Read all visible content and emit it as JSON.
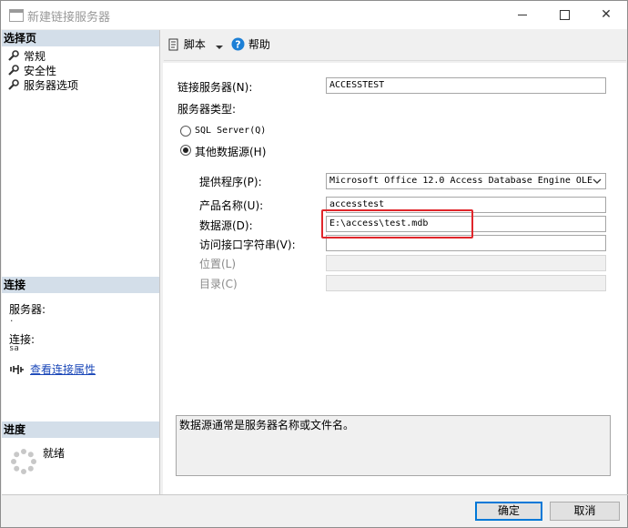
{
  "window": {
    "title": "新建链接服务器",
    "minimize_icon": "minimize-icon",
    "maximize_icon": "maximize-icon",
    "close_icon": "close-icon",
    "close_glyph": "✕"
  },
  "sidebar": {
    "select_page_header": "选择页",
    "pages": [
      {
        "label": "常规",
        "icon": "wrench-icon"
      },
      {
        "label": "安全性",
        "icon": "wrench-icon"
      },
      {
        "label": "服务器选项",
        "icon": "wrench-icon"
      }
    ],
    "connection_header": "连接",
    "server_label": "服务器:",
    "server_value": ".",
    "connection_label": "连接:",
    "connection_value": "sa",
    "view_connection_link": "查看连接属性",
    "progress_header": "进度",
    "progress_status": "就绪"
  },
  "toolbar": {
    "script_label": "脚本",
    "help_label": "帮助"
  },
  "form": {
    "linked_server_label": "链接服务器(N):",
    "linked_server_value": "ACCESSTEST",
    "server_type_label": "服务器类型:",
    "radio_sql_server": "SQL Server(Q)",
    "radio_other": "其他数据源(H)",
    "selected_type": "其他数据源(H)",
    "provider_label": "提供程序(P):",
    "provider_value": "Microsoft Office 12.0 Access Database Engine OLE",
    "product_name_label": "产品名称(U):",
    "product_name_value": "accesstest",
    "data_source_label": "数据源(D):",
    "data_source_value": "E:\\access\\test.mdb",
    "provider_string_label": "访问接口字符串(V):",
    "provider_string_value": "",
    "location_label": "位置(L)",
    "location_value": "",
    "catalog_label": "目录(C)",
    "catalog_value": "",
    "description": "数据源通常是服务器名称或文件名。"
  },
  "buttons": {
    "ok": "确定",
    "cancel": "取消"
  },
  "colors": {
    "section_header_bg": "#d3dee9",
    "link": "#1a47b8",
    "highlight_box": "#e0262b",
    "primary_button_border": "#0078d7"
  }
}
